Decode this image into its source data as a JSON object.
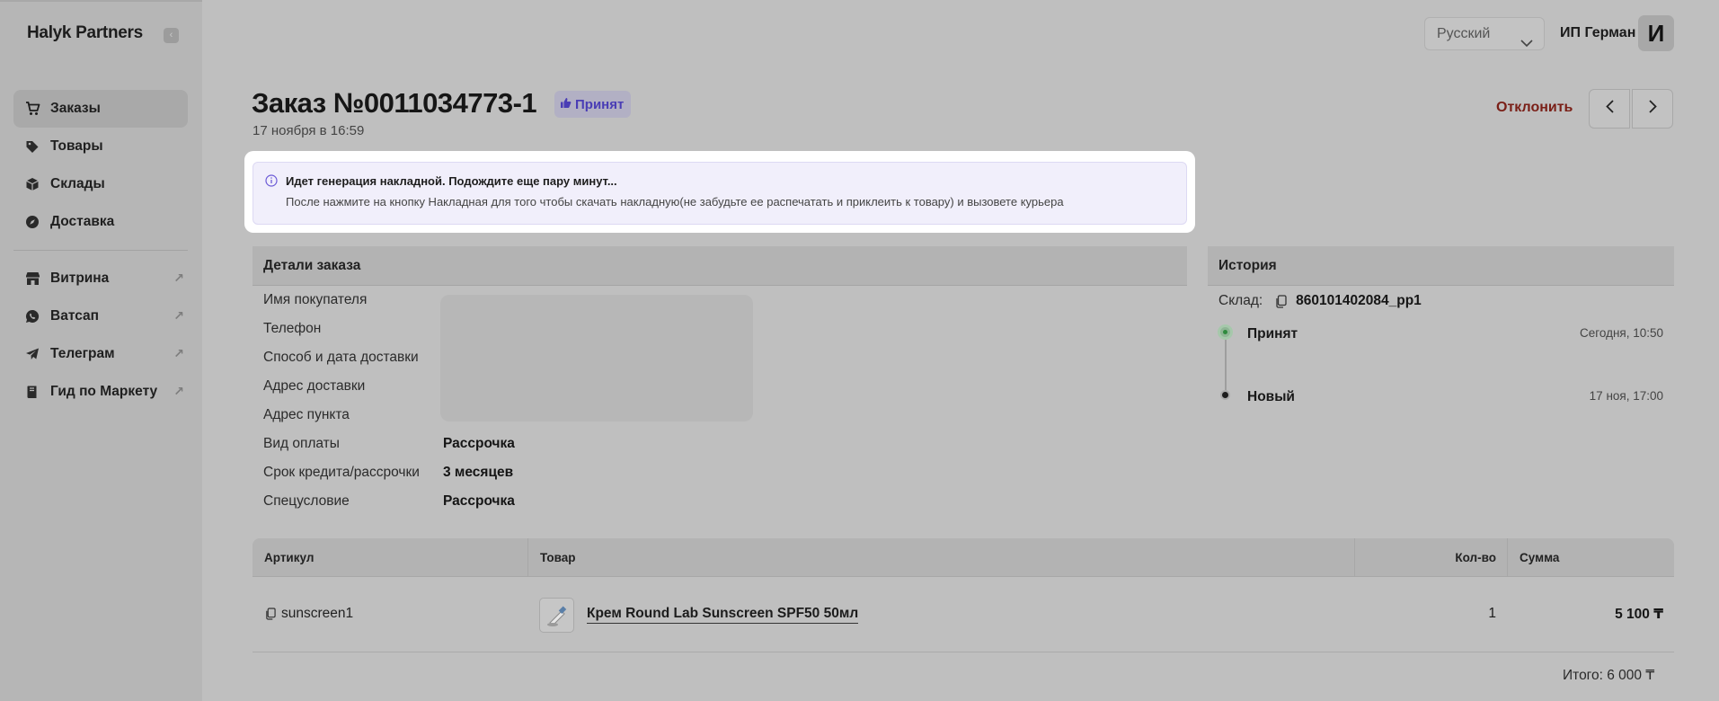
{
  "brand": "Halyk Partners",
  "sidebar": {
    "items": [
      {
        "label": "Заказы",
        "icon": "cart-icon",
        "active": true
      },
      {
        "label": "Товары",
        "icon": "tag-icon"
      },
      {
        "label": "Склады",
        "icon": "box-icon"
      },
      {
        "label": "Доставка",
        "icon": "compass-icon"
      }
    ],
    "links": [
      {
        "label": "Витрина",
        "icon": "storefront-icon"
      },
      {
        "label": "Ватсап",
        "icon": "whatsapp-icon"
      },
      {
        "label": "Телеграм",
        "icon": "telegram-icon"
      },
      {
        "label": "Гид по Маркету",
        "icon": "book-icon"
      }
    ]
  },
  "header": {
    "language": "Русский",
    "user_name": "ИП Герман",
    "avatar_letter": "И"
  },
  "order": {
    "title": "Заказ №0011034773-1",
    "status": "Принят",
    "date": "17 ноября в 16:59",
    "reject_label": "Отклонить"
  },
  "notice": {
    "title": "Идет генерация накладной. Подождите еще пару минут...",
    "text": "После нажмите на кнопку Накладная для того чтобы скачать накладную(не забудьте ее распечатать и приклеить к товару) и вызовете курьера"
  },
  "details": {
    "heading": "Детали заказа",
    "labels": {
      "buyer": "Имя покупателя",
      "phone": "Телефон",
      "delivery_method": "Способ и дата доставки",
      "delivery_address": "Адрес доставки",
      "pickup_address": "Адрес пункта",
      "payment_type": "Вид оплаты",
      "credit_term": "Срок кредита/рассрочки",
      "special": "Спецусловие"
    },
    "values": {
      "payment_type": "Рассрочка",
      "credit_term": "3 месяцев",
      "special": "Рассрочка"
    }
  },
  "history": {
    "heading": "История",
    "warehouse_label": "Склад:",
    "warehouse_id": "860101402084_pp1",
    "events": [
      {
        "name": "Принят",
        "time": "Сегодня, 10:50"
      },
      {
        "name": "Новый",
        "time": "17 ноя, 17:00"
      }
    ]
  },
  "table": {
    "columns": [
      "Артикул",
      "Товар",
      "Кол-во",
      "Сумма"
    ],
    "rows": [
      {
        "sku": "sunscreen1",
        "product": "Крем Round Lab Sunscreen SPF50 50мл",
        "qty": "1",
        "sum": "5 100 ₸"
      }
    ],
    "total": "Итого: 6 000 ₸"
  }
}
